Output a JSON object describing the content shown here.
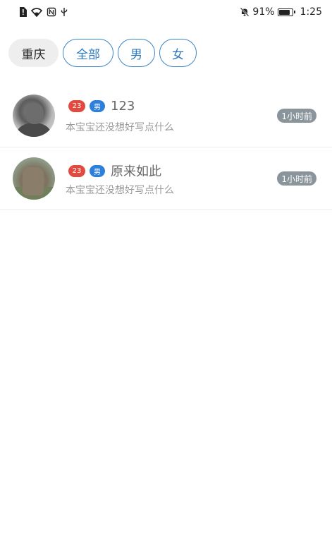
{
  "status_bar": {
    "battery": "91%",
    "battery_level": 0.91,
    "time": "1:25",
    "left_icons": [
      "alert-sim-icon",
      "wifi-icon",
      "nfc-icon",
      "usb-icon"
    ],
    "right_icons": [
      "mute-bell-icon",
      "battery-icon"
    ]
  },
  "filters": {
    "city": "重庆",
    "options": [
      "全部",
      "男",
      "女"
    ]
  },
  "users": [
    {
      "age": "23",
      "gender": "男",
      "nickname": "123",
      "bio": "本宝宝还没想好写点什么",
      "time": "1小时前"
    },
    {
      "age": "23",
      "gender": "男",
      "nickname": "原来如此",
      "bio": "本宝宝还没想好写点什么",
      "time": "1小时前"
    }
  ],
  "colors": {
    "accent_blue": "#2f78bd",
    "age_badge": "#e24a3f",
    "gender_badge": "#2d7fdc",
    "time_pill": "#8a949b"
  }
}
